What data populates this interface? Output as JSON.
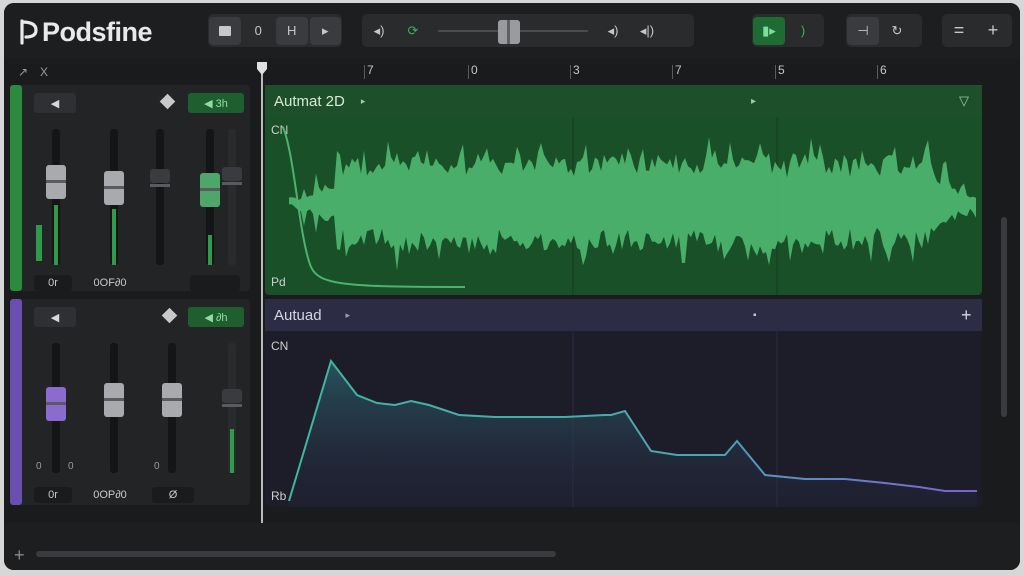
{
  "app": {
    "title": "Podsfine"
  },
  "toolbar": {
    "b1": "",
    "b2": "0",
    "b3": "H",
    "b4": "▸",
    "t1": "◂)",
    "t2": "⟳",
    "t3": "◂)",
    "t4": "◂|)",
    "r1": "▮▸",
    "r2": ")",
    "e1": "⊣",
    "e2": "↻",
    "m1": "=",
    "m2": "+"
  },
  "ruler": {
    "labels": [
      "7",
      "0",
      "3",
      "7",
      "5",
      "6"
    ],
    "left_tools": [
      "↗",
      "X"
    ]
  },
  "mixers": [
    {
      "color": "#2b8a3e",
      "top_left_label": "◀",
      "top_right_label": "◀ 3h",
      "bottom_labels": [
        "0r",
        "0OF∂0",
        ""
      ]
    },
    {
      "color": "#6a4fb0",
      "top_left_label": "◀",
      "top_right_label": "◀ ∂h",
      "bottom_labels": [
        "0r",
        "0OP∂0",
        "Ø"
      ],
      "small_labels": [
        "0",
        "0",
        "0"
      ]
    }
  ],
  "tracks": [
    {
      "name": "Autmat 2D",
      "top_label": "CN",
      "bottom_label": "Pd",
      "colors": {
        "head": "#1e4f2b",
        "lane": "#1a5028"
      }
    },
    {
      "name": "Autuad",
      "top_label": "CN",
      "bottom_label": "Rb",
      "colors": {
        "head": "#2c2c44",
        "lane": "#1d1d2a"
      }
    }
  ],
  "track_icons": {
    "t1_play": "▸",
    "t1_marker": "▸",
    "t1_collapse": "▽",
    "t2_play": "▸",
    "t2_marker": "▪",
    "t2_add": "+"
  },
  "bottom": {
    "add_icon": "+"
  }
}
